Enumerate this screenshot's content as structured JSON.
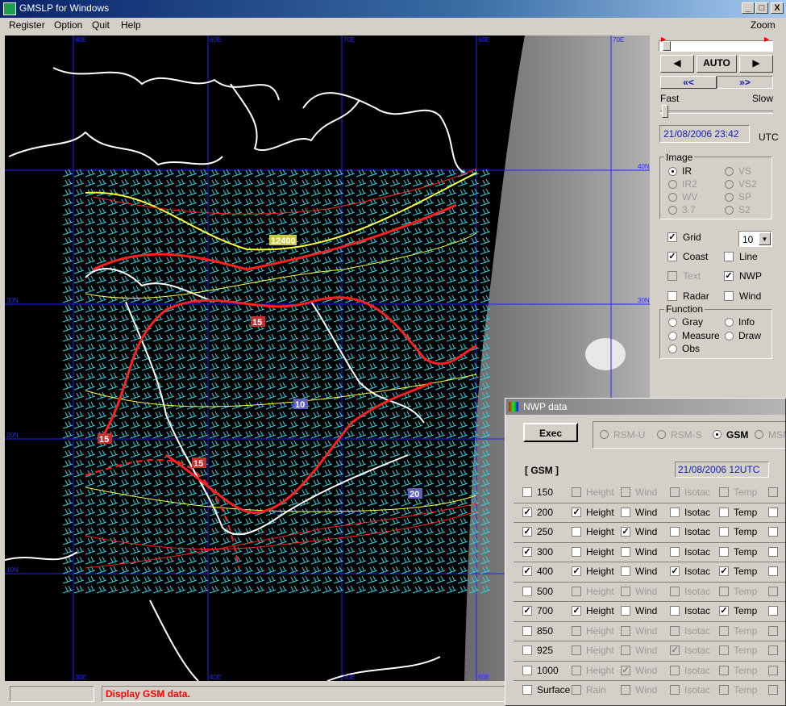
{
  "window": {
    "title": "GMSLP for Windows",
    "min": "_",
    "max": "□",
    "close": "X"
  },
  "menu": [
    "Register",
    "Option",
    "Quit",
    "Help"
  ],
  "zoom_label": "Zoom",
  "map": {
    "grid_labels_top": [
      "80E",
      "60E",
      "70E",
      "60E",
      "70E"
    ],
    "lat_labels": [
      "40N",
      "30N",
      "20N",
      "10N"
    ],
    "lon_labels_bottom": [
      "30E",
      "40E",
      "50E",
      "60E"
    ],
    "contour_labels": [
      "12400",
      "15",
      "15",
      "10",
      "15",
      "20"
    ]
  },
  "status": {
    "message": "Display GSM data."
  },
  "panel": {
    "play_back": "◀",
    "auto": "AUTO",
    "play_fwd": "▶",
    "rew": "«<",
    "ffw": "»>",
    "fast": "Fast",
    "slow": "Slow",
    "datetime": "21/08/2006 23:42",
    "utc": "UTC",
    "image_group": "Image",
    "image_options": [
      {
        "label": "IR",
        "selected": true,
        "enabled": true
      },
      {
        "label": "VS",
        "selected": false,
        "enabled": false
      },
      {
        "label": "IR2",
        "selected": false,
        "enabled": false
      },
      {
        "label": "VS2",
        "selected": false,
        "enabled": false
      },
      {
        "label": "WV",
        "selected": false,
        "enabled": false
      },
      {
        "label": "SP",
        "selected": false,
        "enabled": false
      },
      {
        "label": "3.7",
        "selected": false,
        "enabled": false
      },
      {
        "label": "S2",
        "selected": false,
        "enabled": false
      }
    ],
    "grid": "Grid",
    "grid_value": "10",
    "coast": "Coast",
    "line": "Line",
    "text": "Text",
    "nwp": "NWP",
    "radar": "Radar",
    "wind": "Wind",
    "function_group": "Function",
    "functions": [
      {
        "label": "Gray",
        "selected": false
      },
      {
        "label": "Info",
        "selected": false
      },
      {
        "label": "Measure",
        "selected": false
      },
      {
        "label": "Draw",
        "selected": false
      },
      {
        "label": "Obs",
        "selected": false
      }
    ]
  },
  "nwp": {
    "title": "NWP data",
    "exec": "Exec",
    "models": [
      {
        "label": "RSM-U",
        "selected": false
      },
      {
        "label": "RSM-S",
        "selected": false
      },
      {
        "label": "GSM",
        "selected": true
      },
      {
        "label": "MSM",
        "selected": false
      }
    ],
    "model_label": "[ GSM ]",
    "init_time": "21/08/2006 12UTC",
    "levels": [
      {
        "level": "150",
        "on": false,
        "height": false,
        "wind": false,
        "isotac": false,
        "temp": false,
        "enabled": false
      },
      {
        "level": "200",
        "on": true,
        "height": true,
        "wind": false,
        "isotac": false,
        "temp": false,
        "enabled": true
      },
      {
        "level": "250",
        "on": true,
        "height": false,
        "wind": true,
        "isotac": false,
        "temp": false,
        "enabled": true
      },
      {
        "level": "300",
        "on": true,
        "height": false,
        "wind": false,
        "isotac": false,
        "temp": false,
        "enabled": true
      },
      {
        "level": "400",
        "on": true,
        "height": true,
        "wind": false,
        "isotac": true,
        "temp": true,
        "enabled": true
      },
      {
        "level": "500",
        "on": false,
        "height": false,
        "wind": false,
        "isotac": false,
        "temp": false,
        "enabled": false
      },
      {
        "level": "700",
        "on": true,
        "height": true,
        "wind": false,
        "isotac": false,
        "temp": true,
        "enabled": true
      },
      {
        "level": "850",
        "on": false,
        "height": false,
        "wind": false,
        "isotac": false,
        "temp": false,
        "enabled": false
      },
      {
        "level": "925",
        "on": false,
        "height": false,
        "wind": false,
        "isotac": true,
        "temp": false,
        "enabled": false
      },
      {
        "level": "1000",
        "on": false,
        "height": false,
        "wind": true,
        "isotac": false,
        "temp": false,
        "enabled": false
      },
      {
        "level": "Surface",
        "on": false,
        "height": false,
        "wind": false,
        "isotac": false,
        "temp": false,
        "enabled": false,
        "first": "Rain"
      }
    ],
    "col_labels": [
      "Height",
      "Wind",
      "Isotac",
      "Temp"
    ]
  },
  "colors": {
    "title_bar": "#0a246a",
    "map_bg": "#000000",
    "grid": "#1a1aff",
    "wind": "#27d3e0",
    "contour": "#ff2020",
    "isotherm": "#ffff40",
    "status_text": "#ff0000"
  }
}
